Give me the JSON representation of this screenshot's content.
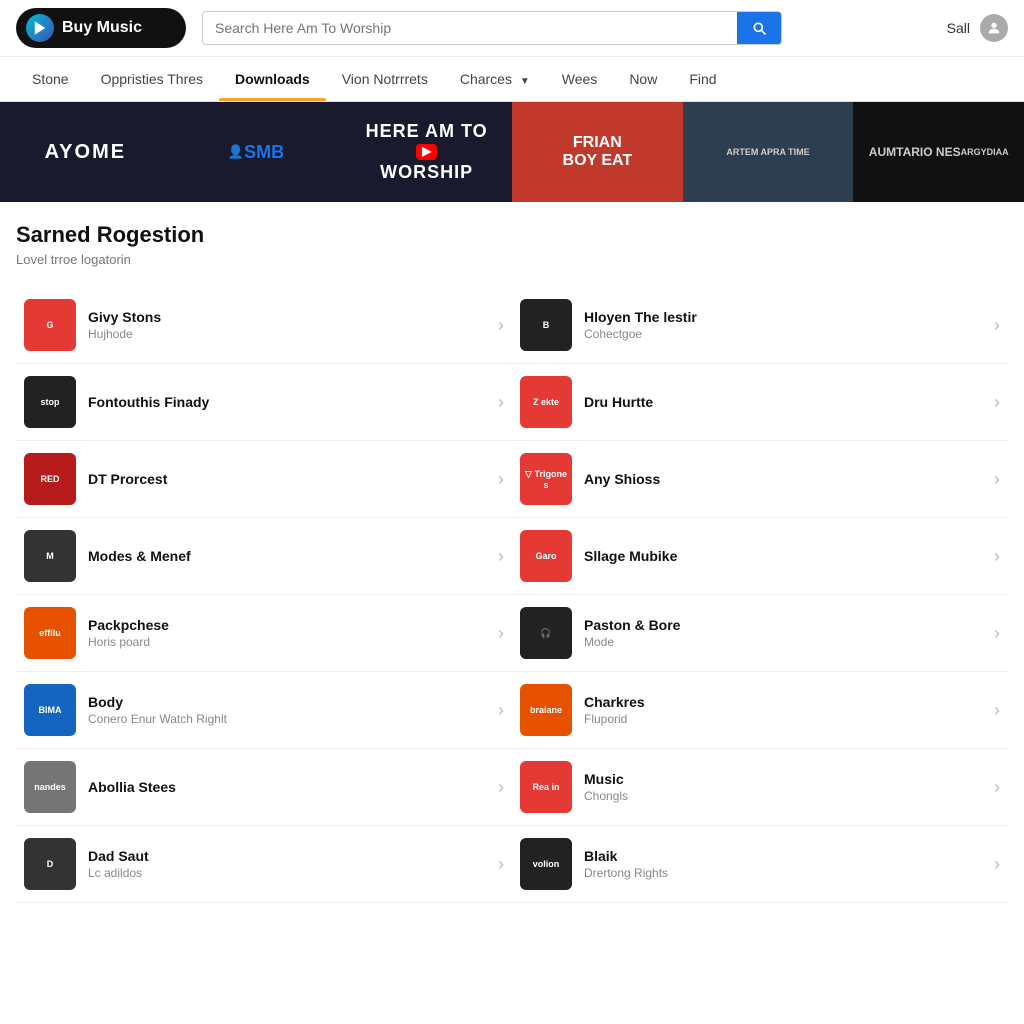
{
  "header": {
    "logo_text": "Buy Music",
    "search_placeholder": "Search Here Am To Worship",
    "user_text": "Sall"
  },
  "nav": {
    "items": [
      {
        "label": "Stone",
        "active": false
      },
      {
        "label": "Oppristies Thres",
        "active": false
      },
      {
        "label": "Downloads",
        "active": true
      },
      {
        "label": "Vion Notrrrets",
        "active": false
      },
      {
        "label": "Charces",
        "active": false,
        "dropdown": true
      },
      {
        "label": "Wees",
        "active": false
      },
      {
        "label": "Now",
        "active": false
      },
      {
        "label": "Find",
        "active": false
      }
    ]
  },
  "banner": {
    "items": [
      {
        "label": "AYOME",
        "class": "banner-ayome"
      },
      {
        "label": "SMB",
        "class": "banner-smb"
      },
      {
        "label": "HERE AM TO WORSHIP",
        "class": "banner-worship"
      },
      {
        "label": "FRIAN BOY EAT",
        "class": "banner-frian"
      },
      {
        "label": "ARTEM APRA TIME",
        "class": "banner-person"
      },
      {
        "label": "AUMTARIO NES",
        "class": "banner-aumtario"
      }
    ]
  },
  "section": {
    "title": "Sarned Rogestion",
    "subtitle": "Lovel trroe logatorin"
  },
  "items_left": [
    {
      "name": "Givy Stons",
      "sub": "Hujhode",
      "thumb_color": "thumb-red",
      "thumb_text": "G"
    },
    {
      "name": "Fontouthis Finady",
      "sub": "",
      "thumb_color": "thumb-black",
      "thumb_text": "stop"
    },
    {
      "name": "DT Prorcest",
      "sub": "",
      "thumb_color": "thumb-dark-red",
      "thumb_text": "RED"
    },
    {
      "name": "Modes & Menef",
      "sub": "",
      "thumb_color": "thumb-dark",
      "thumb_text": "M"
    },
    {
      "name": "Packpchese",
      "sub": "Horis poard",
      "thumb_color": "thumb-orange",
      "thumb_text": "effilu"
    },
    {
      "name": "Body",
      "sub": "Conero Enur Watch Righlt",
      "thumb_color": "thumb-blue",
      "thumb_text": "BIMA"
    },
    {
      "name": "Abollia Stees",
      "sub": "",
      "thumb_color": "thumb-gray",
      "thumb_text": "nandes"
    },
    {
      "name": "Dad Saut",
      "sub": "Lc adildos",
      "thumb_color": "thumb-dark",
      "thumb_text": "D"
    }
  ],
  "items_right": [
    {
      "name": "Hloyen The lestir",
      "sub": "Cohectgoe",
      "thumb_color": "thumb-black",
      "thumb_text": "B"
    },
    {
      "name": "Dru Hurtte",
      "sub": "",
      "thumb_color": "thumb-red",
      "thumb_text": "Z ekte"
    },
    {
      "name": "Any Shioss",
      "sub": "",
      "thumb_color": "thumb-red",
      "thumb_text": "▽ Trigones"
    },
    {
      "name": "Sllage Mubike",
      "sub": "",
      "thumb_color": "thumb-red",
      "thumb_text": "Garo"
    },
    {
      "name": "Paston & Bore",
      "sub": "Mode",
      "thumb_color": "thumb-black",
      "thumb_text": "🎧"
    },
    {
      "name": "Charkres",
      "sub": "Fluporid",
      "thumb_color": "thumb-orange",
      "thumb_text": "braiane"
    },
    {
      "name": "Music",
      "sub": "Chongls",
      "thumb_color": "thumb-red",
      "thumb_text": "Rea in"
    },
    {
      "name": "Blaik",
      "sub": "Drertong Rights",
      "thumb_color": "thumb-black",
      "thumb_text": "volion"
    }
  ]
}
